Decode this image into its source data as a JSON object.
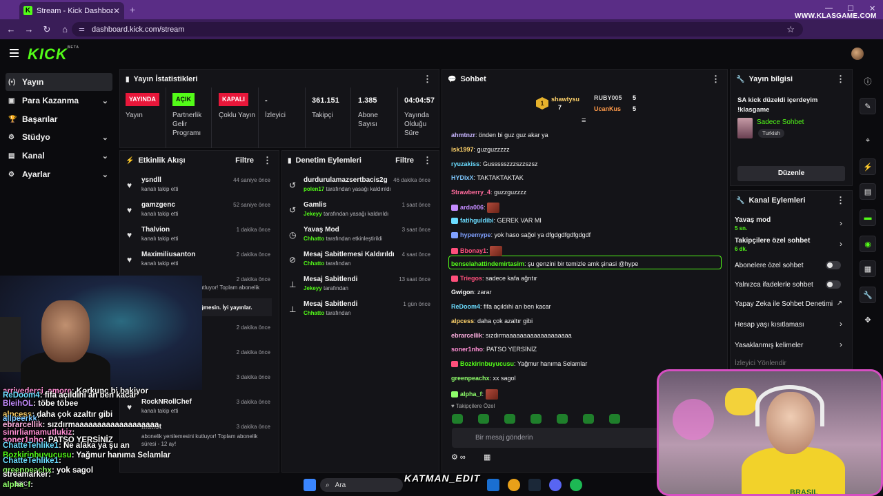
{
  "browser": {
    "tab_title": "Stream - Kick Dashboard",
    "tab_close": "✕",
    "new_tab": "+",
    "url": "dashboard.kick.com/stream",
    "watermark": "WWW.KLASGAME.COM"
  },
  "brand": {
    "logo": "KICK",
    "logo_tag": "BETA",
    "accent": "#53fc18"
  },
  "sidebar": {
    "items": [
      {
        "label": "Yayın",
        "icon": "stream-icon",
        "glyph": "(•)",
        "active": true
      },
      {
        "label": "Para Kazanma",
        "icon": "money-icon",
        "glyph": "▣",
        "chevron": true
      },
      {
        "label": "Başarılar",
        "icon": "trophy-icon",
        "glyph": "🏆"
      },
      {
        "label": "Stüdyo",
        "icon": "studio-icon",
        "glyph": "⚙",
        "chevron": true
      },
      {
        "label": "Kanal",
        "icon": "channel-icon",
        "glyph": "▤",
        "chevron": true
      },
      {
        "label": "Ayarlar",
        "icon": "settings-icon",
        "glyph": "⚙",
        "chevron": true
      }
    ]
  },
  "stats": {
    "title": "Yayın İstatistikleri",
    "items": [
      {
        "badge": "YAYINDA",
        "badge_color": "#e8173a",
        "label": "Yayın"
      },
      {
        "badge": "AÇIK",
        "badge_color": "#53fc18",
        "label": "Partnerlik Gelir Programı"
      },
      {
        "badge": "KAPALI",
        "badge_color": "#e8173a",
        "label": "Çoklu Yayın"
      },
      {
        "value": "-",
        "label": "İzleyici"
      },
      {
        "value": "361.151",
        "label": "Takipçi"
      },
      {
        "value": "1.385",
        "label": "Abone Sayısı"
      },
      {
        "value": "04:04:57",
        "label": "Yayında Olduğu Süre"
      }
    ]
  },
  "activity": {
    "title": "Etkinlik Akışı",
    "filter": "Filtre",
    "rows": [
      {
        "name": "ysndll",
        "sub": "kanalı takip etti",
        "time": "44 saniye önce"
      },
      {
        "name": "gamzgenc",
        "sub": "kanalı takip etti",
        "time": "52 saniye önce"
      },
      {
        "name": "Thalvion",
        "sub": "kanalı takip etti",
        "time": "1 dakika önce"
      },
      {
        "name": "Maximiliusanton",
        "sub": "kanalı takip etti",
        "time": "2 dakika önce"
      }
    ],
    "hidden_rows": [
      {
        "time": "2 dakika önce",
        "text": "utluyor! Toplam abonelik"
      },
      {
        "time": "",
        "text": "ğmesin. İyi yayınlar."
      },
      {
        "time": "2 dakika önce"
      },
      {
        "time": "2 dakika önce"
      },
      {
        "time": "3 dakika önce"
      }
    ],
    "tail_rows": [
      {
        "name": "RockNRollChef",
        "sub": "kanalı takip etti",
        "time": "3 dakika önce"
      },
      {
        "name": "...atist",
        "sub": "abonelik yenilemesini kutluyor! Toplam abonelik süresi - 12 ay!",
        "time": "3 dakika önce"
      }
    ]
  },
  "moderation": {
    "title": "Denetim Eylemleri",
    "filter": "Filtre",
    "rows": [
      {
        "name": "durdurulamazsertbacis2g",
        "actor": "polen17",
        "sub": "tarafından yasağı kaldırıldı",
        "time": "46 dakika önce",
        "glyph": "↺"
      },
      {
        "name": "Gamlis",
        "actor": "Jekeyy",
        "sub": "tarafından yasağı kaldırıldı",
        "time": "1 saat önce",
        "glyph": "↺"
      },
      {
        "name": "Yavaş Mod",
        "actor": "Chhatto",
        "sub": "tarafından etkinleştirildi",
        "time": "3 saat önce",
        "glyph": "◷"
      },
      {
        "name": "Mesaj Sabitlemesi Kaldırıldı",
        "actor": "Chhatto",
        "sub": "tarafından",
        "time": "4 saat önce",
        "glyph": "⊘"
      },
      {
        "name": "Mesaj Sabitlendi",
        "actor": "Jekeyy",
        "sub": "tarafından",
        "time": "13 saat önce",
        "glyph": "⊥"
      },
      {
        "name": "Mesaj Sabitlendi",
        "actor": "Chhatto",
        "sub": "tarafından",
        "time": "1 gün önce",
        "glyph": "⊥"
      }
    ]
  },
  "chat": {
    "title": "Sohbet",
    "top_gifter": {
      "rank": "1",
      "name": "shawtysu",
      "count": "7"
    },
    "gifters": [
      {
        "name": "RUBY005",
        "count": "5"
      },
      {
        "name": "UcanKus",
        "count": "5"
      }
    ],
    "messages": [
      {
        "user": "ahmtnzr",
        "color": "#c9b6ff",
        "text": "önden bi guz guz akar ya"
      },
      {
        "user": "isk1997",
        "color": "#ffd36b",
        "text": "guzguzzzzz"
      },
      {
        "user": "ryuzakiss",
        "color": "#6bdcff",
        "text": "Gussssszzzszzszsz"
      },
      {
        "user": "HYDixX",
        "color": "#7fc8ff",
        "text": "TAKTAKTAKTAK"
      },
      {
        "user": "Strawberry_4",
        "color": "#ff6b9c",
        "text": "guzzguzzzz"
      },
      {
        "user": "arda006",
        "color": "#c48cff",
        "text": "",
        "emote": true
      },
      {
        "user": "fatihguldibi",
        "color": "#6bdcff",
        "text": "GEREK VAR MI"
      },
      {
        "user": "hypemype",
        "color": "#7fa0ff",
        "text": "yok haso sağol ya dfgdgdfgdfgdgdf"
      },
      {
        "user": "Bbonay1",
        "color": "#ff4f7b",
        "text": "",
        "emote": true
      },
      {
        "user": "benselahattindemirtasim",
        "color": "#53fc18",
        "text": "şu genzini bir temizle amk şinasi @hype"
      },
      {
        "user": "Triegos",
        "color": "#ff4f7b",
        "text": "sadece kafa ağrıtır"
      },
      {
        "user": "Gwigon",
        "color": "#ffffff",
        "text": "zarar"
      },
      {
        "user": "ReDoom4",
        "color": "#6bdcff",
        "text": "fifa açıldıhi an ben kacar"
      },
      {
        "user": "alpcess",
        "color": "#ffd36b",
        "text": "daha çok azaltır gibi"
      },
      {
        "user": "ebrarcellik",
        "color": "#ffb0e0",
        "text": "sızdırmaaaaaaaaaaaaaaaaaaa"
      },
      {
        "user": "soner1nho",
        "color": "#ff8fd4",
        "text": "PATSO YERSİNİZ"
      },
      {
        "user": "Bozkirinbuyucusu",
        "color": "#53fc18",
        "text": "Yağmur hanıma Selamlar"
      },
      {
        "user": "greenpeachx",
        "color": "#8fff6b",
        "text": "xx sagol"
      },
      {
        "user": "alpha_f",
        "color": "#8fff6b",
        "text": "",
        "emote": true
      }
    ],
    "followers_only": "Takipçilere Özel",
    "input_placeholder": "Bir mesaj gönderin"
  },
  "stream_info": {
    "title": "Yayın bilgisi",
    "stream_title": "SA kick düzeldi içerdeyim !klasgame",
    "category": "Sadece Sohbet",
    "language": "Turkish",
    "edit_button": "Düzenle"
  },
  "channel_actions": {
    "title": "Kanal Eylemleri",
    "items": [
      {
        "label": "Yavaş mod",
        "sub": "5 sn.",
        "control": "caret"
      },
      {
        "label": "Takipçilere özel sohbet",
        "sub": "6 dk.",
        "control": "caret"
      },
      {
        "label": "Abonelere özel sohbet",
        "control": "toggle"
      },
      {
        "label": "Yalnızca ifadelerle sohbet",
        "control": "toggle"
      },
      {
        "label": "Yapay Zeka ile Sohbet Denetimi",
        "control": "external"
      },
      {
        "label": "Hesap yaşı kısıtlaması",
        "control": "caret"
      },
      {
        "label": "Yasaklanmış kelimeler",
        "control": "caret"
      },
      {
        "label": "İzleyici Yönlendir",
        "control": "none"
      }
    ]
  },
  "overlay_chat": [
    {
      "user": "arrivederci_amore",
      "text": ": Korkunç bi bakiyor",
      "color": "#ff8fd4"
    },
    {
      "user": "ReDoom4",
      "text": ": fifa açıldıhi an ben kacar",
      "color": "#6bdcff"
    },
    {
      "user": "BleihOL",
      "text": ": töbe töbee",
      "color": "#c48cff"
    },
    {
      "user": "alpcess",
      "text": ": daha çok azaltır gibi",
      "color": "#ffd36b"
    },
    {
      "user": "allpeerkk",
      "text": ":",
      "color": "#7fc8ff"
    },
    {
      "user": "ebrarcellik",
      "text": ": sızdırmaaaaaaaaaaaaaaaaaaa",
      "color": "#ffb0e0"
    },
    {
      "user": "sinirliamamutlukiz",
      "text": ":",
      "color": "#ff8fd4"
    },
    {
      "user": "soner1nho",
      "text": ": PATSO YERSİNİZ",
      "color": "#ff8fd4"
    },
    {
      "user": "ChatteTehlike1",
      "text": ": Ne alaka ya şu an",
      "color": "#6bdcff"
    },
    {
      "user": "Bozkirinbuyucusu",
      "text": ": Yağmur hanıma Selamlar",
      "color": "#53fc18"
    },
    {
      "user": "ChatteTehlike1",
      "text": ":",
      "color": "#6bdcff"
    },
    {
      "user": "greenpeachx",
      "text": ": yok sagol",
      "color": "#8fff6b"
    },
    {
      "user": "streamarker",
      "text": ":",
      "color": "#ffffff"
    },
    {
      "user": "alpha_f",
      "text": ":",
      "color": "#8fff6b"
    }
  ],
  "taskbar": {
    "search": "Ara",
    "weather": "18°C",
    "watermark": "KATMAN_EDIT"
  },
  "cam2": {
    "jersey_text": "BRASIL"
  }
}
